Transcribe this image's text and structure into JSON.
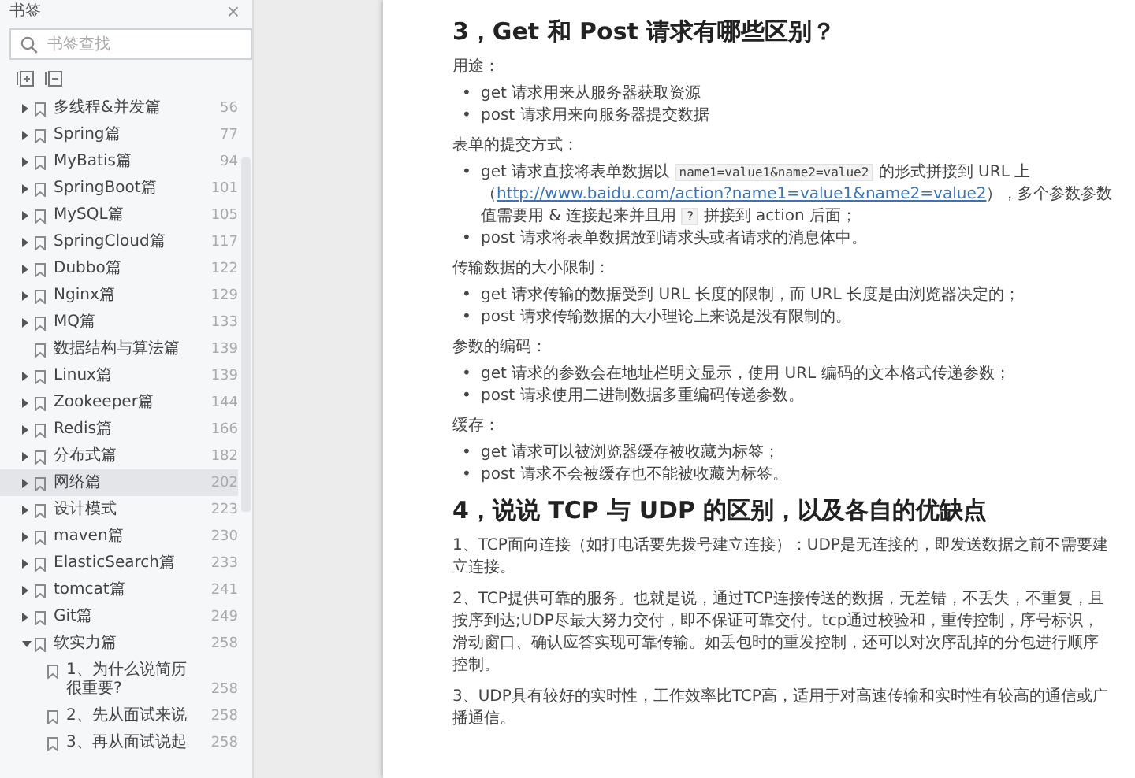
{
  "sidebar": {
    "title": "书签",
    "close": "×",
    "search": {
      "placeholder": "书签查找"
    },
    "items": [
      {
        "label": "多线程&并发篇",
        "page": "56",
        "kind": "folder",
        "expanded": false,
        "selected": false
      },
      {
        "label": "Spring篇",
        "page": "77",
        "kind": "folder",
        "expanded": false,
        "selected": false
      },
      {
        "label": "MyBatis篇",
        "page": "94",
        "kind": "folder",
        "expanded": false,
        "selected": false
      },
      {
        "label": "SpringBoot篇",
        "page": "101",
        "kind": "folder",
        "expanded": false,
        "selected": false
      },
      {
        "label": "MySQL篇",
        "page": "105",
        "kind": "folder",
        "expanded": false,
        "selected": false
      },
      {
        "label": "SpringCloud篇",
        "page": "117",
        "kind": "folder",
        "expanded": false,
        "selected": false
      },
      {
        "label": "Dubbo篇",
        "page": "122",
        "kind": "folder",
        "expanded": false,
        "selected": false
      },
      {
        "label": "Nginx篇",
        "page": "129",
        "kind": "folder",
        "expanded": false,
        "selected": false
      },
      {
        "label": "MQ篇",
        "page": "133",
        "kind": "folder",
        "expanded": false,
        "selected": false
      },
      {
        "label": "数据结构与算法篇",
        "page": "139",
        "kind": "leaf",
        "selected": false
      },
      {
        "label": "Linux篇",
        "page": "139",
        "kind": "folder",
        "expanded": false,
        "selected": false
      },
      {
        "label": "Zookeeper篇",
        "page": "144",
        "kind": "folder",
        "expanded": false,
        "selected": false
      },
      {
        "label": "Redis篇",
        "page": "166",
        "kind": "folder",
        "expanded": false,
        "selected": false
      },
      {
        "label": "分布式篇",
        "page": "182",
        "kind": "folder",
        "expanded": false,
        "selected": false
      },
      {
        "label": "网络篇",
        "page": "202",
        "kind": "folder",
        "expanded": false,
        "selected": true
      },
      {
        "label": "设计模式",
        "page": "223",
        "kind": "folder",
        "expanded": false,
        "selected": false
      },
      {
        "label": "maven篇",
        "page": "230",
        "kind": "folder",
        "expanded": false,
        "selected": false
      },
      {
        "label": "ElasticSearch篇",
        "page": "233",
        "kind": "folder",
        "expanded": false,
        "selected": false
      },
      {
        "label": "tomcat篇",
        "page": "241",
        "kind": "folder",
        "expanded": false,
        "selected": false
      },
      {
        "label": "Git篇",
        "page": "249",
        "kind": "folder",
        "expanded": false,
        "selected": false
      },
      {
        "label": "软实力篇",
        "page": "258",
        "kind": "folder",
        "expanded": true,
        "selected": false,
        "children": [
          {
            "label": "1、为什么说简历很重要?",
            "page": "258",
            "selected": false
          },
          {
            "label": "2、先从面试来说",
            "page": "258",
            "selected": false
          },
          {
            "label": "3、再从面试说起",
            "page": "258",
            "selected": false
          }
        ]
      }
    ]
  },
  "document": {
    "blocks": [
      {
        "kind": "heading",
        "text": "3，Get 和 Post 请求有哪些区别？"
      },
      {
        "kind": "label",
        "text": "用途："
      },
      {
        "kind": "list",
        "bullet": "•",
        "items": [
          "get 请求用来从服务器获取资源",
          "post 请求用来向服务器提交数据"
        ]
      },
      {
        "kind": "label",
        "text": "表单的提交方式："
      },
      {
        "kind": "list",
        "bullet": "•",
        "items": [
          {
            "parts": [
              {
                "kind": "text",
                "text": "get 请求直接将表单数据以 "
              },
              {
                "kind": "code",
                "text": "name1=value1&name2=value2"
              },
              {
                "kind": "text",
                "text": " 的形式拼接到 URL 上（"
              },
              {
                "kind": "link",
                "text": "http://www.baidu.com/action?name1=value1&name2=value2"
              },
              {
                "kind": "text",
                "text": "），多个参数参数值需要用 & 连接起来并且用 "
              },
              {
                "kind": "code",
                "text": "?"
              },
              {
                "kind": "text",
                "text": " 拼接到 action 后面；"
              }
            ]
          },
          "post 请求将表单数据放到请求头或者请求的消息体中。"
        ]
      },
      {
        "kind": "label",
        "text": "传输数据的大小限制："
      },
      {
        "kind": "list",
        "bullet": "•",
        "items": [
          "get 请求传输的数据受到 URL 长度的限制，而 URL 长度是由浏览器决定的；",
          "post 请求传输数据的大小理论上来说是没有限制的。"
        ]
      },
      {
        "kind": "label",
        "text": "参数的编码："
      },
      {
        "kind": "list",
        "bullet": "•",
        "items": [
          "get 请求的参数会在地址栏明文显示，使用 URL 编码的文本格式传递参数；",
          "post 请求使用二进制数据多重编码传递参数。"
        ]
      },
      {
        "kind": "label",
        "text": "缓存："
      },
      {
        "kind": "list",
        "bullet": "•",
        "items": [
          "get 请求可以被浏览器缓存被收藏为标签；",
          "post 请求不会被缓存也不能被收藏为标签。"
        ]
      },
      {
        "kind": "heading",
        "text": "4，说说 TCP 与 UDP 的区别，以及各自的优缺点"
      },
      {
        "kind": "para",
        "text": "1、TCP面向连接（如打电话要先拨号建立连接）：UDP是无连接的，即发送数据之前不需要建立连接。"
      },
      {
        "kind": "para",
        "text": "2、TCP提供可靠的服务。也就是说，通过TCP连接传送的数据，无差错，不丢失，不重复，且按序到达;UDP尽最大努力交付，即不保证可靠交付。tcp通过校验和，重传控制，序号标识，滑动窗口、确认应答实现可靠传输。如丢包时的重发控制，还可以对次序乱掉的分包进行顺序控制。"
      },
      {
        "kind": "para",
        "text": "3、UDP具有较好的实时性，工作效率比TCP高，适用于对高速传输和实时性有较高的通信或广播通信。"
      }
    ]
  }
}
